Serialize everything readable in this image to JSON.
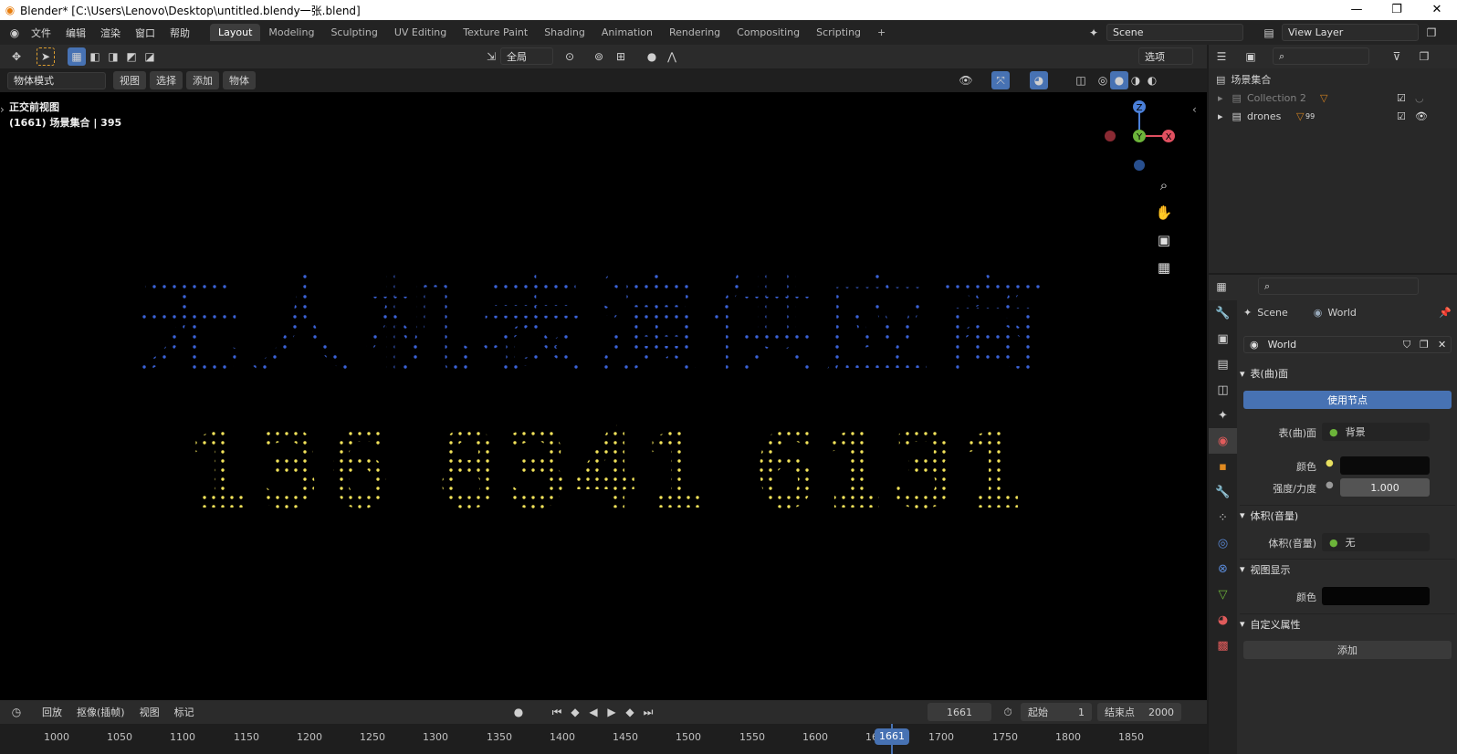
{
  "window": {
    "title": "Blender* [C:\\Users\\Lenovo\\Desktop\\untitled.blendy一张.blend]",
    "minimize": "—",
    "maximize": "❐",
    "close": "✕"
  },
  "menu": [
    "文件",
    "编辑",
    "渲染",
    "窗口",
    "帮助"
  ],
  "workspaces": [
    "Layout",
    "Modeling",
    "Sculpting",
    "UV Editing",
    "Texture Paint",
    "Shading",
    "Animation",
    "Rendering",
    "Compositing",
    "Scripting"
  ],
  "active_workspace": "Layout",
  "add_workspace": "+",
  "scene": {
    "name": "Scene",
    "view_layer": "View Layer"
  },
  "tool_header": {
    "transform": "全局",
    "options": "选项"
  },
  "view_header": {
    "mode": "物体模式",
    "items": [
      "视图",
      "选择",
      "添加",
      "物体"
    ]
  },
  "viewport": {
    "view_name": "正交前视图",
    "collection_info": "(1661) 场景集合 | 395",
    "text_rows": [
      {
        "text": "无人机表演供应商",
        "color": "#3a62d8"
      },
      {
        "text": "136 8341 6131",
        "color": "#f2e35a"
      }
    ],
    "gizmo": {
      "z": "Z",
      "y": "Y",
      "x": "X"
    }
  },
  "outliner": {
    "root": "场景集合",
    "items": [
      {
        "name": "Collection 2",
        "badge": ""
      },
      {
        "name": "drones",
        "badge": "99"
      }
    ]
  },
  "properties": {
    "breadcrumb": {
      "scene": "Scene",
      "world": "World"
    },
    "world_name": "World",
    "surface_panel": "表(曲)面",
    "use_nodes": "使用节点",
    "surface_label": "表(曲)面",
    "surface_value": "背景",
    "color_label": "颜色",
    "strength_label": "强度/力度",
    "strength_value": "1.000",
    "volume_panel": "体积(音量)",
    "volume_label": "体积(音量)",
    "volume_value": "无",
    "viewport_panel": "视图显示",
    "viewport_color_label": "颜色",
    "custom_panel": "自定义属性",
    "add_button": "添加"
  },
  "timeline": {
    "items": [
      "回放",
      "抠像(插帧)",
      "视图",
      "标记"
    ],
    "current_frame": "1661",
    "start_label": "起始",
    "start_value": "1",
    "end_label": "结束点",
    "end_value": "2000",
    "ruler": [
      "1000",
      "1050",
      "1100",
      "1150",
      "1200",
      "1250",
      "1300",
      "1350",
      "1400",
      "1450",
      "1500",
      "1550",
      "1600",
      "16",
      "1700",
      "1750",
      "1800",
      "1850"
    ],
    "playhead": "1661"
  },
  "colors": {
    "accent": "#4772b3",
    "playhead": "#4772b3",
    "world_active": "#e05b5b"
  }
}
